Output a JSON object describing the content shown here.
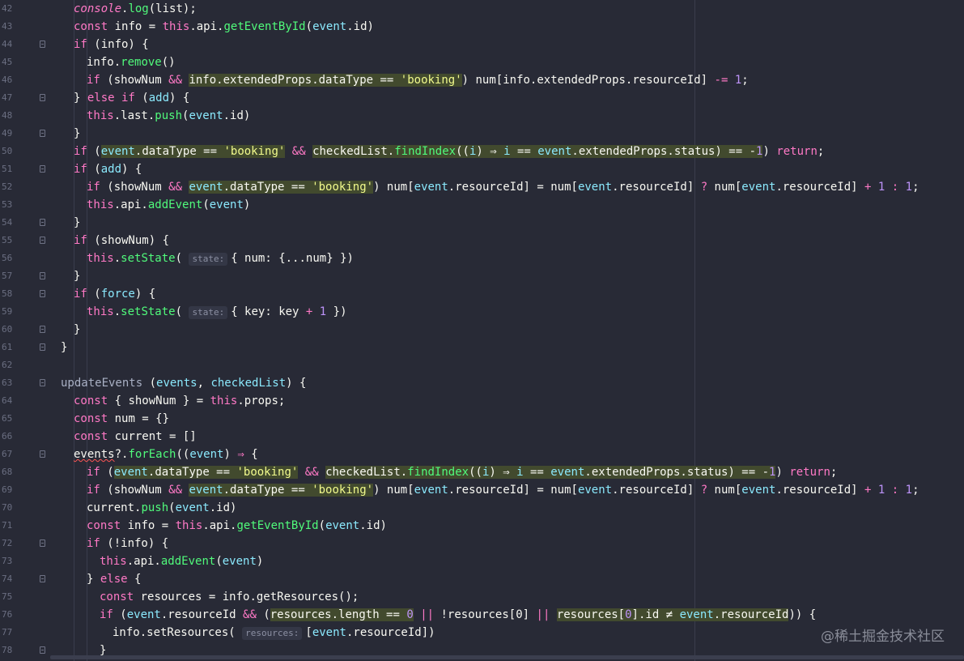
{
  "watermark": "@稀土掘金技术社区",
  "lines": [
    {
      "n": "42",
      "indent": 1,
      "tokens": [
        [
          "it",
          "console"
        ],
        [
          "pl",
          "."
        ],
        [
          "fn",
          "log"
        ],
        [
          "pl",
          "(list);"
        ]
      ]
    },
    {
      "n": "43",
      "indent": 1,
      "tokens": [
        [
          "kw",
          "const"
        ],
        [
          "pl",
          " info = "
        ],
        [
          "kw",
          "this"
        ],
        [
          "pl",
          ".api."
        ],
        [
          "fn",
          "getEventById"
        ],
        [
          "pl",
          "("
        ],
        [
          "prop",
          "event"
        ],
        [
          "pl",
          ".id)"
        ]
      ]
    },
    {
      "n": "44",
      "indent": 1,
      "fold": true,
      "tokens": [
        [
          "kw",
          "if"
        ],
        [
          "pl",
          " (info) {"
        ]
      ]
    },
    {
      "n": "45",
      "indent": 2,
      "tokens": [
        [
          "pl",
          "info."
        ],
        [
          "fn",
          "remove"
        ],
        [
          "pl",
          "()"
        ]
      ]
    },
    {
      "n": "46",
      "indent": 2,
      "tokens": [
        [
          "kw",
          "if"
        ],
        [
          "pl",
          " (showNum "
        ],
        [
          "op",
          "&&"
        ],
        [
          "pl",
          " "
        ],
        [
          "hl",
          "info.extendedProps.dataType == 'booking'"
        ],
        [
          "pl",
          ") num[info.extendedProps.resourceId] "
        ],
        [
          "op",
          "-="
        ],
        [
          "pl",
          " "
        ],
        [
          "num",
          "1"
        ],
        [
          "pl",
          ";"
        ]
      ]
    },
    {
      "n": "47",
      "indent": 1,
      "fold": true,
      "tokens": [
        [
          "pl",
          "} "
        ],
        [
          "kw",
          "else if"
        ],
        [
          "pl",
          " ("
        ],
        [
          "prop",
          "add"
        ],
        [
          "pl",
          ") {"
        ]
      ]
    },
    {
      "n": "48",
      "indent": 2,
      "tokens": [
        [
          "kw",
          "this"
        ],
        [
          "pl",
          ".last."
        ],
        [
          "fn",
          "push"
        ],
        [
          "pl",
          "("
        ],
        [
          "prop",
          "event"
        ],
        [
          "pl",
          ".id)"
        ]
      ]
    },
    {
      "n": "49",
      "indent": 1,
      "fold": true,
      "tokens": [
        [
          "pl",
          "}"
        ]
      ]
    },
    {
      "n": "50",
      "indent": 1,
      "tokens": [
        [
          "kw",
          "if"
        ],
        [
          "pl",
          " ("
        ],
        [
          "hl",
          "event.dataType == 'booking'"
        ],
        [
          "pl",
          " "
        ],
        [
          "op",
          "&&"
        ],
        [
          "pl",
          " "
        ],
        [
          "hl",
          "checkedList.findIndex((i) ⇒ i == event.extendedProps.status) == -1"
        ],
        [
          "pl",
          ") "
        ],
        [
          "kw",
          "return"
        ],
        [
          "pl",
          ";"
        ]
      ]
    },
    {
      "n": "51",
      "indent": 1,
      "fold": true,
      "tokens": [
        [
          "kw",
          "if"
        ],
        [
          "pl",
          " ("
        ],
        [
          "prop",
          "add"
        ],
        [
          "pl",
          ") {"
        ]
      ]
    },
    {
      "n": "52",
      "indent": 2,
      "tokens": [
        [
          "kw",
          "if"
        ],
        [
          "pl",
          " (showNum "
        ],
        [
          "op",
          "&&"
        ],
        [
          "pl",
          " "
        ],
        [
          "hl",
          "event.dataType == 'booking'"
        ],
        [
          "pl",
          ") num["
        ],
        [
          "prop",
          "event"
        ],
        [
          "pl",
          ".resourceId] = num["
        ],
        [
          "prop",
          "event"
        ],
        [
          "pl",
          ".resourceId] "
        ],
        [
          "op",
          "?"
        ],
        [
          "pl",
          " num["
        ],
        [
          "prop",
          "event"
        ],
        [
          "pl",
          ".resourceId] "
        ],
        [
          "op",
          "+"
        ],
        [
          "pl",
          " "
        ],
        [
          "num",
          "1"
        ],
        [
          "pl",
          " "
        ],
        [
          "op",
          ":"
        ],
        [
          "pl",
          " "
        ],
        [
          "num",
          "1"
        ],
        [
          "pl",
          ";"
        ]
      ]
    },
    {
      "n": "53",
      "indent": 2,
      "tokens": [
        [
          "kw",
          "this"
        ],
        [
          "pl",
          ".api."
        ],
        [
          "fn",
          "addEvent"
        ],
        [
          "pl",
          "("
        ],
        [
          "prop",
          "event"
        ],
        [
          "pl",
          ")"
        ]
      ]
    },
    {
      "n": "54",
      "indent": 1,
      "fold": true,
      "tokens": [
        [
          "pl",
          "}"
        ]
      ]
    },
    {
      "n": "55",
      "indent": 1,
      "fold": true,
      "tokens": [
        [
          "kw",
          "if"
        ],
        [
          "pl",
          " (showNum) {"
        ]
      ]
    },
    {
      "n": "56",
      "indent": 2,
      "tokens": [
        [
          "kw",
          "this"
        ],
        [
          "pl",
          "."
        ],
        [
          "fn",
          "setState"
        ],
        [
          "pl",
          "( "
        ],
        [
          "hint",
          "state:"
        ],
        [
          "pl",
          "{ num: {...num} })"
        ]
      ]
    },
    {
      "n": "57",
      "indent": 1,
      "fold": true,
      "tokens": [
        [
          "pl",
          "}"
        ]
      ]
    },
    {
      "n": "58",
      "indent": 1,
      "fold": true,
      "tokens": [
        [
          "kw",
          "if"
        ],
        [
          "pl",
          " ("
        ],
        [
          "prop",
          "force"
        ],
        [
          "pl",
          ") {"
        ]
      ]
    },
    {
      "n": "59",
      "indent": 2,
      "tokens": [
        [
          "kw",
          "this"
        ],
        [
          "pl",
          "."
        ],
        [
          "fn",
          "setState"
        ],
        [
          "pl",
          "( "
        ],
        [
          "hint",
          "state:"
        ],
        [
          "pl",
          "{ key: key "
        ],
        [
          "op",
          "+"
        ],
        [
          "pl",
          " "
        ],
        [
          "num",
          "1"
        ],
        [
          "pl",
          " })"
        ]
      ]
    },
    {
      "n": "60",
      "indent": 1,
      "fold": true,
      "tokens": [
        [
          "pl",
          "}"
        ]
      ]
    },
    {
      "n": "61",
      "indent": 0,
      "fold": true,
      "tokens": [
        [
          "pl",
          "}"
        ]
      ]
    },
    {
      "n": "62",
      "indent": 0,
      "tokens": []
    },
    {
      "n": "63",
      "indent": 0,
      "fold": true,
      "tokens": [
        [
          "cm",
          "updateEvents"
        ],
        [
          "pl",
          " ("
        ],
        [
          "prop",
          "events"
        ],
        [
          "pl",
          ", "
        ],
        [
          "prop",
          "checkedList"
        ],
        [
          "pl",
          ") {"
        ]
      ]
    },
    {
      "n": "64",
      "indent": 1,
      "tokens": [
        [
          "kw",
          "const"
        ],
        [
          "pl",
          " { showNum } = "
        ],
        [
          "kw",
          "this"
        ],
        [
          "pl",
          ".props;"
        ]
      ]
    },
    {
      "n": "65",
      "indent": 1,
      "tokens": [
        [
          "kw",
          "const"
        ],
        [
          "pl",
          " num = {}"
        ]
      ]
    },
    {
      "n": "66",
      "indent": 1,
      "tokens": [
        [
          "kw",
          "const"
        ],
        [
          "pl",
          " current = []"
        ]
      ]
    },
    {
      "n": "67",
      "indent": 1,
      "fold": true,
      "tokens": [
        [
          "wavy",
          "events"
        ],
        [
          "pl",
          "?."
        ],
        [
          "fn",
          "forEach"
        ],
        [
          "pl",
          "(("
        ],
        [
          "prop",
          "event"
        ],
        [
          "pl",
          ") "
        ],
        [
          "op",
          "⇒"
        ],
        [
          "pl",
          " {"
        ]
      ]
    },
    {
      "n": "68",
      "indent": 2,
      "tokens": [
        [
          "kw",
          "if"
        ],
        [
          "pl",
          " ("
        ],
        [
          "hl",
          "event.dataType == 'booking'"
        ],
        [
          "pl",
          " "
        ],
        [
          "op",
          "&&"
        ],
        [
          "pl",
          " "
        ],
        [
          "hl",
          "checkedList.findIndex((i) ⇒ i == event.extendedProps.status) == -1"
        ],
        [
          "pl",
          ") "
        ],
        [
          "kw",
          "return"
        ],
        [
          "pl",
          ";"
        ]
      ]
    },
    {
      "n": "69",
      "indent": 2,
      "tokens": [
        [
          "kw",
          "if"
        ],
        [
          "pl",
          " (showNum "
        ],
        [
          "op",
          "&&"
        ],
        [
          "pl",
          " "
        ],
        [
          "hl",
          "event.dataType == 'booking'"
        ],
        [
          "pl",
          ") num["
        ],
        [
          "prop",
          "event"
        ],
        [
          "pl",
          ".resourceId] = num["
        ],
        [
          "prop",
          "event"
        ],
        [
          "pl",
          ".resourceId] "
        ],
        [
          "op",
          "?"
        ],
        [
          "pl",
          " num["
        ],
        [
          "prop",
          "event"
        ],
        [
          "pl",
          ".resourceId] "
        ],
        [
          "op",
          "+"
        ],
        [
          "pl",
          " "
        ],
        [
          "num",
          "1"
        ],
        [
          "pl",
          " "
        ],
        [
          "op",
          ":"
        ],
        [
          "pl",
          " "
        ],
        [
          "num",
          "1"
        ],
        [
          "pl",
          ";"
        ]
      ]
    },
    {
      "n": "70",
      "indent": 2,
      "tokens": [
        [
          "pl",
          "current."
        ],
        [
          "fn",
          "push"
        ],
        [
          "pl",
          "("
        ],
        [
          "prop",
          "event"
        ],
        [
          "pl",
          ".id)"
        ]
      ]
    },
    {
      "n": "71",
      "indent": 2,
      "tokens": [
        [
          "kw",
          "const"
        ],
        [
          "pl",
          " info = "
        ],
        [
          "kw",
          "this"
        ],
        [
          "pl",
          ".api."
        ],
        [
          "fn",
          "getEventById"
        ],
        [
          "pl",
          "("
        ],
        [
          "prop",
          "event"
        ],
        [
          "pl",
          ".id)"
        ]
      ]
    },
    {
      "n": "72",
      "indent": 2,
      "fold": true,
      "tokens": [
        [
          "kw",
          "if"
        ],
        [
          "pl",
          " (!info) {"
        ]
      ]
    },
    {
      "n": "73",
      "indent": 3,
      "tokens": [
        [
          "kw",
          "this"
        ],
        [
          "pl",
          ".api."
        ],
        [
          "fn",
          "addEvent"
        ],
        [
          "pl",
          "("
        ],
        [
          "prop",
          "event"
        ],
        [
          "pl",
          ")"
        ]
      ]
    },
    {
      "n": "74",
      "indent": 2,
      "fold": true,
      "tokens": [
        [
          "pl",
          "} "
        ],
        [
          "kw",
          "else"
        ],
        [
          "pl",
          " {"
        ]
      ]
    },
    {
      "n": "75",
      "indent": 3,
      "tokens": [
        [
          "kw",
          "const"
        ],
        [
          "pl",
          " resources = info.getResources();"
        ]
      ]
    },
    {
      "n": "76",
      "indent": 3,
      "tokens": [
        [
          "kw",
          "if"
        ],
        [
          "pl",
          " ("
        ],
        [
          "prop",
          "event"
        ],
        [
          "pl",
          ".resourceId "
        ],
        [
          "op",
          "&&"
        ],
        [
          "pl",
          " ("
        ],
        [
          "hl",
          "resources.length == 0"
        ],
        [
          "pl",
          " "
        ],
        [
          "op",
          "||"
        ],
        [
          "pl",
          " !resources[0] "
        ],
        [
          "op",
          "||"
        ],
        [
          "pl",
          " "
        ],
        [
          "hl",
          "resources[0].id ≠ event.resourceId"
        ],
        [
          "pl",
          ")) {"
        ]
      ]
    },
    {
      "n": "77",
      "indent": 4,
      "tokens": [
        [
          "pl",
          "info.setResources( "
        ],
        [
          "hint",
          "resources:"
        ],
        [
          "pl",
          "["
        ],
        [
          "prop",
          "event"
        ],
        [
          "pl",
          ".resourceId])"
        ]
      ]
    },
    {
      "n": "78",
      "indent": 3,
      "fold": true,
      "tokens": [
        [
          "pl",
          "}"
        ]
      ]
    }
  ]
}
